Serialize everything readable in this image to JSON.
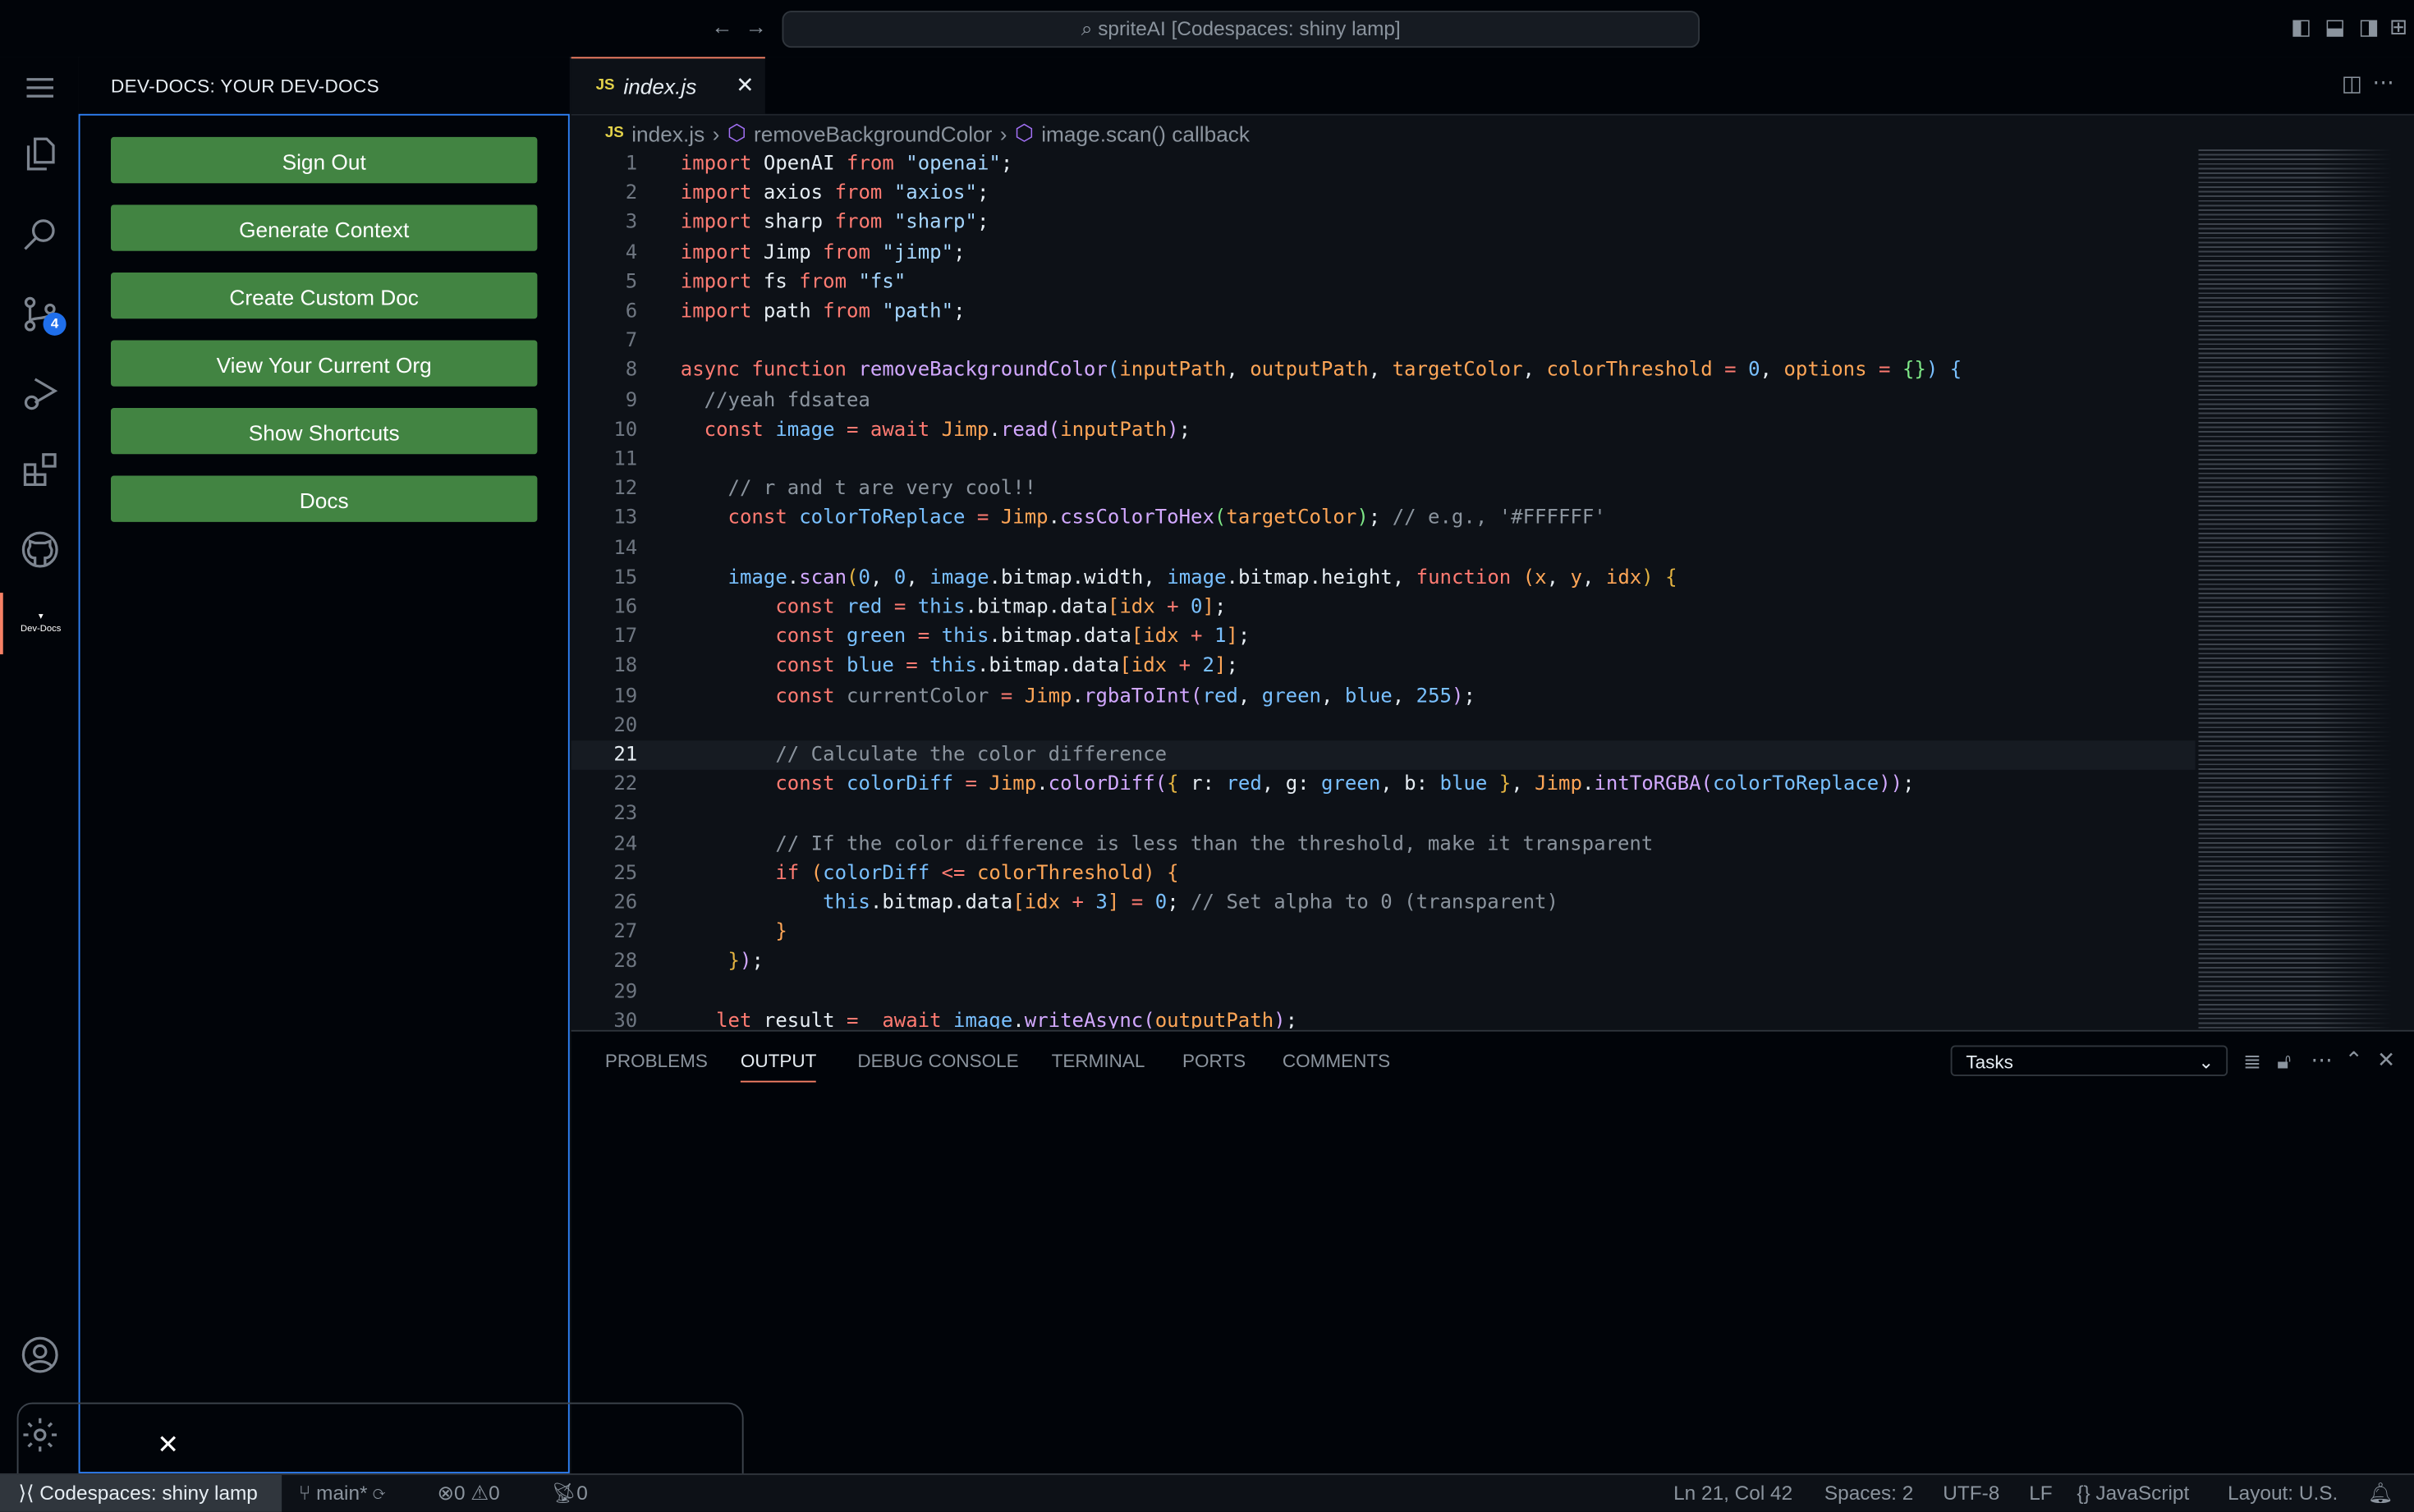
{
  "titlebar": {
    "command_center": "spriteAI [Codespaces: shiny lamp]"
  },
  "activity": {
    "items": [
      "explorer",
      "search",
      "source-control",
      "run-debug",
      "extensions",
      "github",
      "dev-docs"
    ],
    "scm_badge": "4",
    "devdocs_label": "Dev-Docs"
  },
  "sidebar": {
    "title": "DEV-DOCS: YOUR DEV-DOCS",
    "buttons": [
      "Sign Out",
      "Generate Context",
      "Create Custom Doc",
      "View Your Current Org",
      "Show Shortcuts",
      "Docs"
    ],
    "button_color": "#428442"
  },
  "editor": {
    "tab_icon": "JS",
    "tab_label": "index.js",
    "breadcrumbs": [
      "index.js",
      "removeBackgroundColor",
      "image.scan() callback"
    ],
    "current_line": 21,
    "lines": [
      [
        [
          "kw",
          "import"
        ],
        [
          "id",
          " OpenAI "
        ],
        [
          "kw",
          "from"
        ],
        [
          "str",
          " \"openai\""
        ],
        [
          "id",
          ";"
        ]
      ],
      [
        [
          "kw",
          "import"
        ],
        [
          "id",
          " axios "
        ],
        [
          "kw",
          "from"
        ],
        [
          "str",
          " \"axios\""
        ],
        [
          "id",
          ";"
        ]
      ],
      [
        [
          "kw",
          "import"
        ],
        [
          "id",
          " sharp "
        ],
        [
          "kw",
          "from"
        ],
        [
          "str",
          " \"sharp\""
        ],
        [
          "id",
          ";"
        ]
      ],
      [
        [
          "kw",
          "import"
        ],
        [
          "id",
          " Jimp "
        ],
        [
          "kw",
          "from"
        ],
        [
          "str",
          " \"jimp\""
        ],
        [
          "id",
          ";"
        ]
      ],
      [
        [
          "kw",
          "import"
        ],
        [
          "id",
          " fs "
        ],
        [
          "kw",
          "from"
        ],
        [
          "str",
          " \"fs\""
        ]
      ],
      [
        [
          "kw",
          "import"
        ],
        [
          "id",
          " path "
        ],
        [
          "kw",
          "from"
        ],
        [
          "str",
          " \"path\""
        ],
        [
          "id",
          ";"
        ]
      ],
      [],
      [
        [
          "kw",
          "async function "
        ],
        [
          "fn",
          "removeBackgroundColor"
        ],
        [
          "v",
          "("
        ],
        [
          "p",
          "inputPath"
        ],
        [
          "id",
          ", "
        ],
        [
          "p",
          "outputPath"
        ],
        [
          "id",
          ", "
        ],
        [
          "p",
          "targetColor"
        ],
        [
          "id",
          ", "
        ],
        [
          "p",
          "colorThreshold"
        ],
        [
          "kw",
          " = "
        ],
        [
          "v",
          "0"
        ],
        [
          "id",
          ", "
        ],
        [
          "p",
          "options"
        ],
        [
          "kw",
          " = "
        ],
        [
          "g",
          "{}"
        ],
        [
          "v",
          ")"
        ],
        [
          "id",
          " "
        ],
        [
          "v",
          "{"
        ]
      ],
      [
        [
          "c",
          "  //yeah fdsatea"
        ]
      ],
      [
        [
          "kw",
          "  const "
        ],
        [
          "v",
          "image"
        ],
        [
          "kw",
          " = await "
        ],
        [
          "p",
          "Jimp"
        ],
        [
          "id",
          "."
        ],
        [
          "fn",
          "read"
        ],
        [
          "fn",
          "("
        ],
        [
          "p",
          "inputPath"
        ],
        [
          "fn",
          ")"
        ],
        [
          "id",
          ";"
        ]
      ],
      [],
      [
        [
          "c",
          "    // r and t are very cool!!"
        ]
      ],
      [
        [
          "kw",
          "    const "
        ],
        [
          "v",
          "colorToReplace"
        ],
        [
          "kw",
          " = "
        ],
        [
          "p",
          "Jimp"
        ],
        [
          "id",
          "."
        ],
        [
          "fn",
          "cssColorToHex"
        ],
        [
          "g",
          "("
        ],
        [
          "p",
          "targetColor"
        ],
        [
          "g",
          ")"
        ],
        [
          "id",
          "; "
        ],
        [
          "c",
          "// e.g., '#FFFFFF'"
        ]
      ],
      [],
      [
        [
          "v",
          "    image"
        ],
        [
          "id",
          "."
        ],
        [
          "fn",
          "scan"
        ],
        [
          "br",
          "("
        ],
        [
          "v",
          "0"
        ],
        [
          "id",
          ", "
        ],
        [
          "v",
          "0"
        ],
        [
          "id",
          ", "
        ],
        [
          "v",
          "image"
        ],
        [
          "id",
          ".bitmap.width, "
        ],
        [
          "v",
          "image"
        ],
        [
          "id",
          ".bitmap.height, "
        ],
        [
          "kw",
          "function "
        ],
        [
          "p",
          "(x"
        ],
        [
          "id",
          ", "
        ],
        [
          "p",
          "y"
        ],
        [
          "id",
          ", "
        ],
        [
          "p",
          "idx"
        ],
        [
          "br",
          ") {"
        ]
      ],
      [
        [
          "kw",
          "        const "
        ],
        [
          "v",
          "red"
        ],
        [
          "kw",
          " = "
        ],
        [
          "v",
          "this"
        ],
        [
          "id",
          ".bitmap.data"
        ],
        [
          "p",
          "[idx "
        ],
        [
          "kw",
          "+"
        ],
        [
          "v",
          " 0"
        ],
        [
          "p",
          "]"
        ],
        [
          "id",
          ";"
        ]
      ],
      [
        [
          "kw",
          "        const "
        ],
        [
          "v",
          "green"
        ],
        [
          "kw",
          " = "
        ],
        [
          "v",
          "this"
        ],
        [
          "id",
          ".bitmap.data"
        ],
        [
          "p",
          "[idx "
        ],
        [
          "kw",
          "+"
        ],
        [
          "v",
          " 1"
        ],
        [
          "p",
          "]"
        ],
        [
          "id",
          ";"
        ]
      ],
      [
        [
          "kw",
          "        const "
        ],
        [
          "v",
          "blue"
        ],
        [
          "kw",
          " = "
        ],
        [
          "v",
          "this"
        ],
        [
          "id",
          ".bitmap.data"
        ],
        [
          "p",
          "[idx "
        ],
        [
          "kw",
          "+"
        ],
        [
          "v",
          " 2"
        ],
        [
          "p",
          "]"
        ],
        [
          "id",
          ";"
        ]
      ],
      [
        [
          "kw",
          "        const "
        ],
        [
          "c",
          "currentColor"
        ],
        [
          "kw",
          " = "
        ],
        [
          "p",
          "Jimp"
        ],
        [
          "id",
          "."
        ],
        [
          "fn",
          "rgbaToInt"
        ],
        [
          "fn",
          "("
        ],
        [
          "v",
          "red"
        ],
        [
          "id",
          ", "
        ],
        [
          "v",
          "green"
        ],
        [
          "id",
          ", "
        ],
        [
          "v",
          "blue"
        ],
        [
          "id",
          ", "
        ],
        [
          "v",
          "255"
        ],
        [
          "fn",
          ")"
        ],
        [
          "id",
          ";"
        ]
      ],
      [],
      [
        [
          "c",
          "        // Calculate the color difference"
        ]
      ],
      [
        [
          "kw",
          "        const "
        ],
        [
          "v",
          "colorDiff"
        ],
        [
          "kw",
          " = "
        ],
        [
          "p",
          "Jimp"
        ],
        [
          "id",
          "."
        ],
        [
          "fn",
          "colorDiff"
        ],
        [
          "fn",
          "("
        ],
        [
          "br",
          "{"
        ],
        [
          "id",
          " r: "
        ],
        [
          "v",
          "red"
        ],
        [
          "id",
          ", g: "
        ],
        [
          "v",
          "green"
        ],
        [
          "id",
          ", b: "
        ],
        [
          "v",
          "blue"
        ],
        [
          "br",
          " }"
        ],
        [
          "id",
          ", "
        ],
        [
          "p",
          "Jimp"
        ],
        [
          "id",
          "."
        ],
        [
          "fn",
          "intToRGBA"
        ],
        [
          "fn",
          "("
        ],
        [
          "v",
          "colorToReplace"
        ],
        [
          "fn",
          "))"
        ],
        [
          "id",
          ";"
        ]
      ],
      [],
      [
        [
          "c",
          "        // If the color difference is less than the threshold, make it transparent"
        ]
      ],
      [
        [
          "kw",
          "        if "
        ],
        [
          "p",
          "("
        ],
        [
          "v",
          "colorDiff"
        ],
        [
          "kw",
          " <= "
        ],
        [
          "p",
          "colorThreshold) {"
        ]
      ],
      [
        [
          "v",
          "            this"
        ],
        [
          "id",
          ".bitmap.data"
        ],
        [
          "p",
          "[idx "
        ],
        [
          "kw",
          "+"
        ],
        [
          "v",
          " 3"
        ],
        [
          "p",
          "]"
        ],
        [
          "kw",
          " = "
        ],
        [
          "v",
          "0"
        ],
        [
          "id",
          "; "
        ],
        [
          "c",
          "// Set alpha to 0 (transparent)"
        ]
      ],
      [
        [
          "p",
          "        }"
        ]
      ],
      [
        [
          "br",
          "    }"
        ],
        [
          "fn",
          ")"
        ],
        [
          "id",
          ";"
        ]
      ],
      [],
      [
        [
          "kw",
          "   let "
        ],
        [
          "id",
          "result "
        ],
        [
          "kw",
          "=  await "
        ],
        [
          "v",
          "image"
        ],
        [
          "id",
          "."
        ],
        [
          "fn",
          "writeAsync"
        ],
        [
          "fn",
          "("
        ],
        [
          "p",
          "outputPath"
        ],
        [
          "fn",
          ")"
        ],
        [
          "id",
          ";"
        ]
      ]
    ]
  },
  "panel": {
    "tabs": [
      "PROBLEMS",
      "OUTPUT",
      "DEBUG CONSOLE",
      "TERMINAL",
      "PORTS",
      "COMMENTS"
    ],
    "active_tab": "OUTPUT",
    "output_channel": "Tasks"
  },
  "status": {
    "remote": "Codespaces: shiny lamp",
    "branch": "main*",
    "errors": "0",
    "warnings": "0",
    "ports": "0",
    "position": "Ln 21, Col 42",
    "spaces": "Spaces: 2",
    "encoding": "UTF-8",
    "eol": "LF",
    "language": "JavaScript",
    "layout": "Layout: U.S."
  },
  "overlay": {
    "close": "✕"
  }
}
